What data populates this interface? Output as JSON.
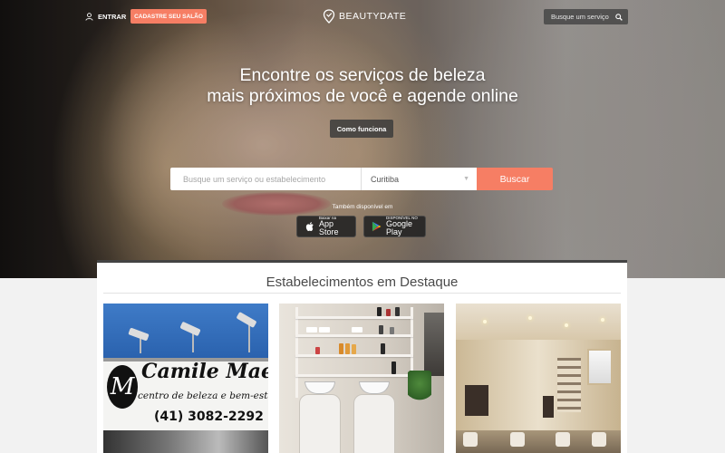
{
  "header": {
    "login_label": "ENTRAR",
    "register_label": "CADASTRE SEU SALÃO",
    "logo_text": "BEAUTYDATE",
    "search_placeholder": "Busque um serviço"
  },
  "hero": {
    "headline_line1": "Encontre os serviços de beleza",
    "headline_line2": "mais próximos de você e agende online",
    "how_it_works_label": "Como funciona",
    "search": {
      "placeholder": "Busque um serviço ou estabelecimento",
      "city_value": "Curitiba",
      "button_label": "Buscar"
    },
    "also_available": "Também disponível em",
    "app_store": {
      "small": "Baixar na",
      "big": "App Store"
    },
    "google_play": {
      "small": "DISPONÍVEL NO",
      "big": "Google Play"
    }
  },
  "featured": {
    "title": "Estabelecimentos em Destaque",
    "cards": [
      {
        "sign_monogram": "M",
        "sign_name": "Camile Maes",
        "sign_tagline": "centro de beleza e bem-estar",
        "sign_phone": "(41) 3082-2292"
      },
      {
        "kind": "salon-interior-wash-station"
      },
      {
        "kind": "salon-interior-hall"
      }
    ]
  },
  "colors": {
    "accent": "#f67e64",
    "dark_button": "#3c3c3c",
    "text_dark": "#4a4a4a"
  },
  "icons": [
    "user-icon",
    "location-pin-icon",
    "search-icon",
    "apple-icon",
    "google-play-icon",
    "chevron-down-icon"
  ]
}
